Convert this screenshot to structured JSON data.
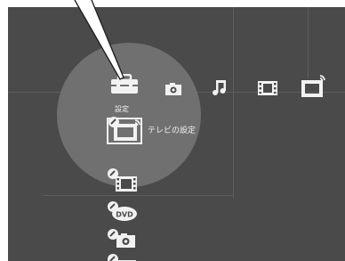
{
  "category_bar": {
    "items": [
      {
        "name": "settings",
        "icon": "toolbox-icon",
        "label": "設定",
        "selected": true
      },
      {
        "name": "photo",
        "icon": "camera-icon"
      },
      {
        "name": "music",
        "icon": "music-note-icon"
      },
      {
        "name": "video",
        "icon": "film-icon"
      },
      {
        "name": "tv",
        "icon": "tv-broadcast-icon"
      }
    ]
  },
  "settings_list": {
    "items": [
      {
        "name": "tv-settings",
        "icon": "tv-settings-icon",
        "label": "テレビの設定",
        "selected": true
      },
      {
        "name": "video-settings",
        "icon": "video-settings-icon"
      },
      {
        "name": "dvd-settings",
        "icon": "dvd-settings-icon",
        "badge": "DVD"
      },
      {
        "name": "photo-settings",
        "icon": "photo-settings-icon"
      },
      {
        "name": "more-settings",
        "icon": "settings-icon"
      }
    ]
  },
  "colors": {
    "background": "#4a4a4a",
    "highlight": "#707070",
    "icon": "#f2f2f2",
    "grid": "#5e5e5e"
  }
}
